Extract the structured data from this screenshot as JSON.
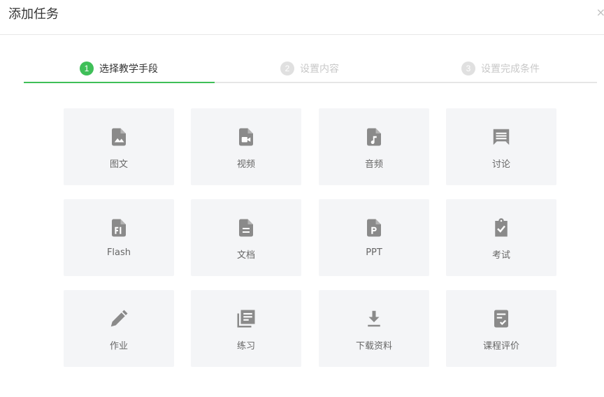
{
  "dialog": {
    "title": "添加任务",
    "close_icon": "×"
  },
  "steps": [
    {
      "num": "1",
      "label": "选择教学手段",
      "active": true
    },
    {
      "num": "2",
      "label": "设置内容",
      "active": false
    },
    {
      "num": "3",
      "label": "设置完成条件",
      "active": false
    }
  ],
  "tools": [
    {
      "label": "图文",
      "icon": "image-file-icon"
    },
    {
      "label": "视频",
      "icon": "video-file-icon"
    },
    {
      "label": "音频",
      "icon": "audio-file-icon"
    },
    {
      "label": "讨论",
      "icon": "comment-icon"
    },
    {
      "label": "Flash",
      "icon": "flash-file-icon"
    },
    {
      "label": "文档",
      "icon": "document-file-icon"
    },
    {
      "label": "PPT",
      "icon": "ppt-file-icon"
    },
    {
      "label": "考试",
      "icon": "exam-clipboard-icon"
    },
    {
      "label": "作业",
      "icon": "pencil-icon"
    },
    {
      "label": "练习",
      "icon": "library-books-icon"
    },
    {
      "label": "下载资料",
      "icon": "download-icon"
    },
    {
      "label": "课程评价",
      "icon": "evaluation-icon"
    }
  ],
  "colors": {
    "accent": "#3fbf58",
    "icon": "#8a8a8a",
    "card_bg": "#f4f5f7"
  }
}
